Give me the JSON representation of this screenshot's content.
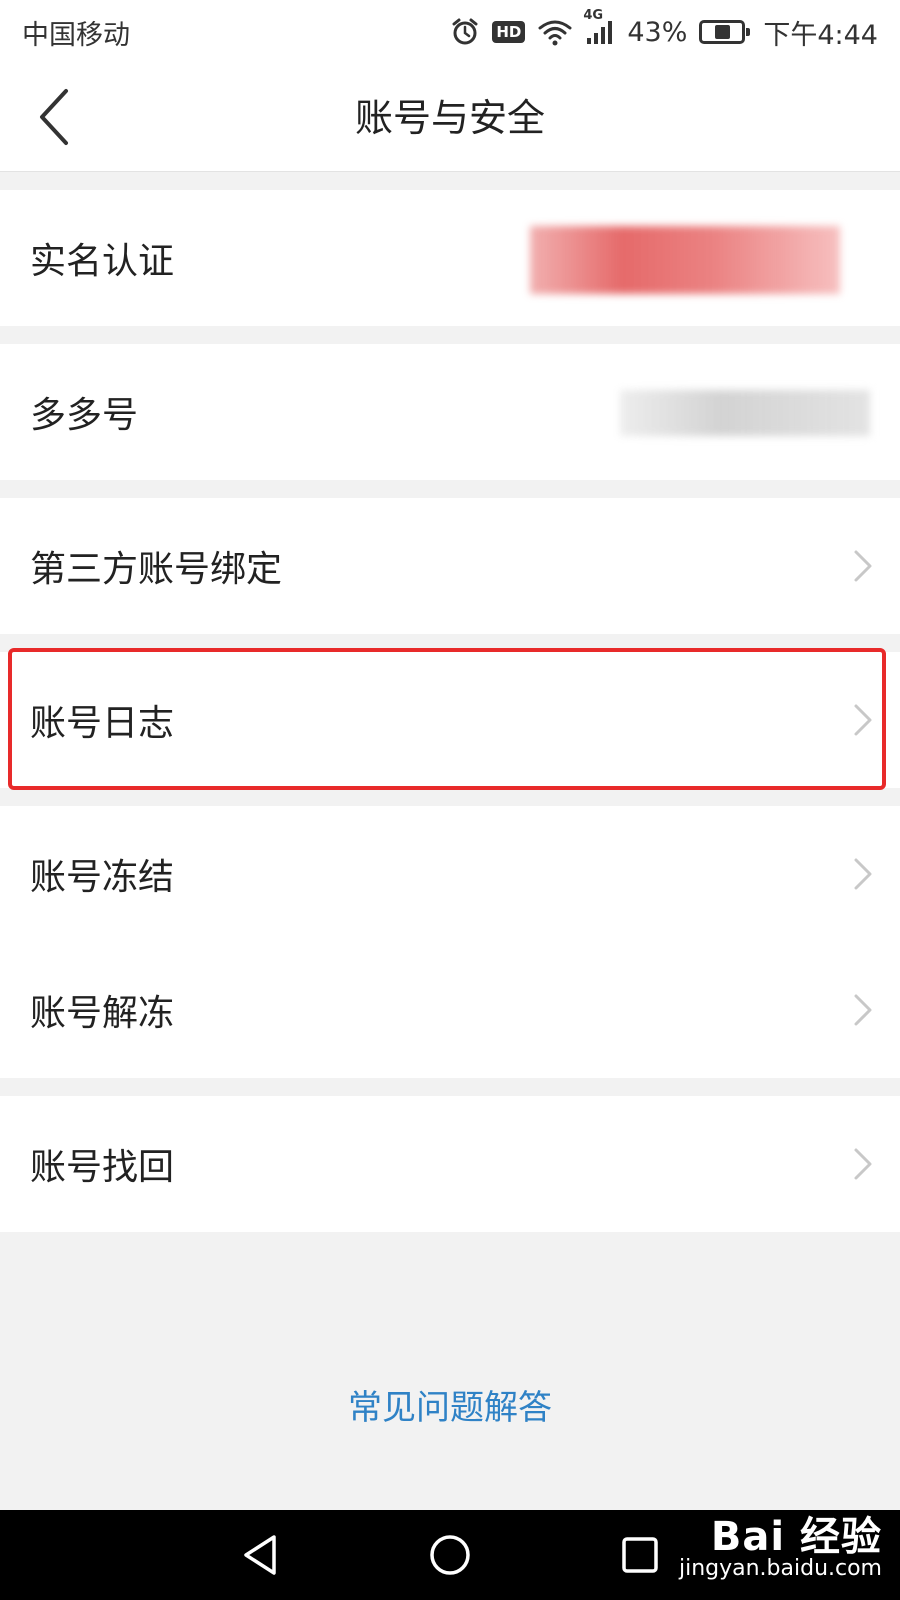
{
  "status_bar": {
    "carrier": "中国移动",
    "network": "4G",
    "battery_percent": "43%",
    "battery_level": 0.43,
    "time": "下午4:44",
    "hd_label": "HD",
    "icons": [
      "alarm-icon",
      "hd-icon",
      "wifi-icon",
      "signal-icon",
      "battery-icon"
    ]
  },
  "header": {
    "title": "账号与安全",
    "back_icon": "chevron-left-icon"
  },
  "menu": {
    "real_name": "实名认证",
    "duoduo_id": "多多号",
    "third_party": "第三方账号绑定",
    "account_log": "账号日志",
    "freeze": "账号冻结",
    "unfreeze": "账号解冻",
    "recover": "账号找回"
  },
  "footer": {
    "faq": "常见问题解答"
  },
  "system_nav": {
    "icons": [
      "back-triangle-icon",
      "home-circle-icon",
      "recents-square-icon"
    ]
  },
  "watermark": {
    "logo": "Bai 经验",
    "url": "jingyan.baidu.com"
  },
  "colors": {
    "highlight": "#e82a2a",
    "link": "#2f82c6",
    "background": "#f2f2f2"
  }
}
